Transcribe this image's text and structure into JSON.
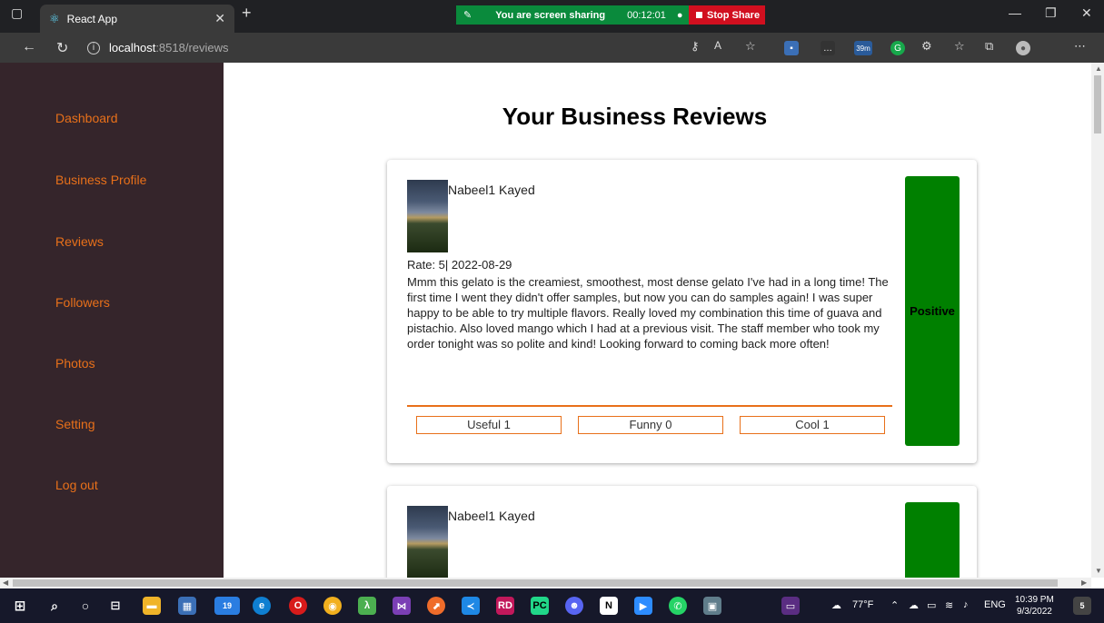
{
  "browser": {
    "tab_title": "React App",
    "share": {
      "status": "You are screen sharing",
      "timer": "00:12:01",
      "stop_label": "Stop Share"
    },
    "url_host": "localhost",
    "url_path": ":8518/reviews"
  },
  "sidebar": {
    "items": [
      {
        "label": "Dashboard"
      },
      {
        "label": "Business Profile"
      },
      {
        "label": "Reviews"
      },
      {
        "label": "Followers"
      },
      {
        "label": "Photos"
      },
      {
        "label": "Setting"
      },
      {
        "label": "Log out"
      }
    ]
  },
  "main": {
    "title": "Your Business Reviews",
    "reviews": [
      {
        "reviewer": "Nabeel1 Kayed",
        "rate_line": "Rate: 5| 2022-08-29",
        "text": "Mmm this gelato is the creamiest, smoothest, most dense gelato I've had in a long time! The first time I went they didn't offer samples, but now you can do samples again! I was super happy to be able to try multiple flavors. Really loved my combination this time of guava and pistachio. Also loved mango which I had at a previous visit. The staff member who took my order tonight was so polite and kind! Looking forward to coming back more often!",
        "useful": "Useful 1",
        "funny": "Funny 0",
        "cool": "Cool 1",
        "sentiment": "Positive"
      },
      {
        "reviewer": "Nabeel1 Kayed"
      }
    ]
  },
  "taskbar": {
    "badge": "19",
    "weather": "77°F",
    "lang": "ENG",
    "time": "10:39 PM",
    "date": "9/3/2022",
    "notif_count": "5",
    "ext_badge": "39m"
  },
  "colors": {
    "accent": "#e8701a",
    "sidebar_bg": "#35252b",
    "sentiment_positive": "#008000"
  }
}
